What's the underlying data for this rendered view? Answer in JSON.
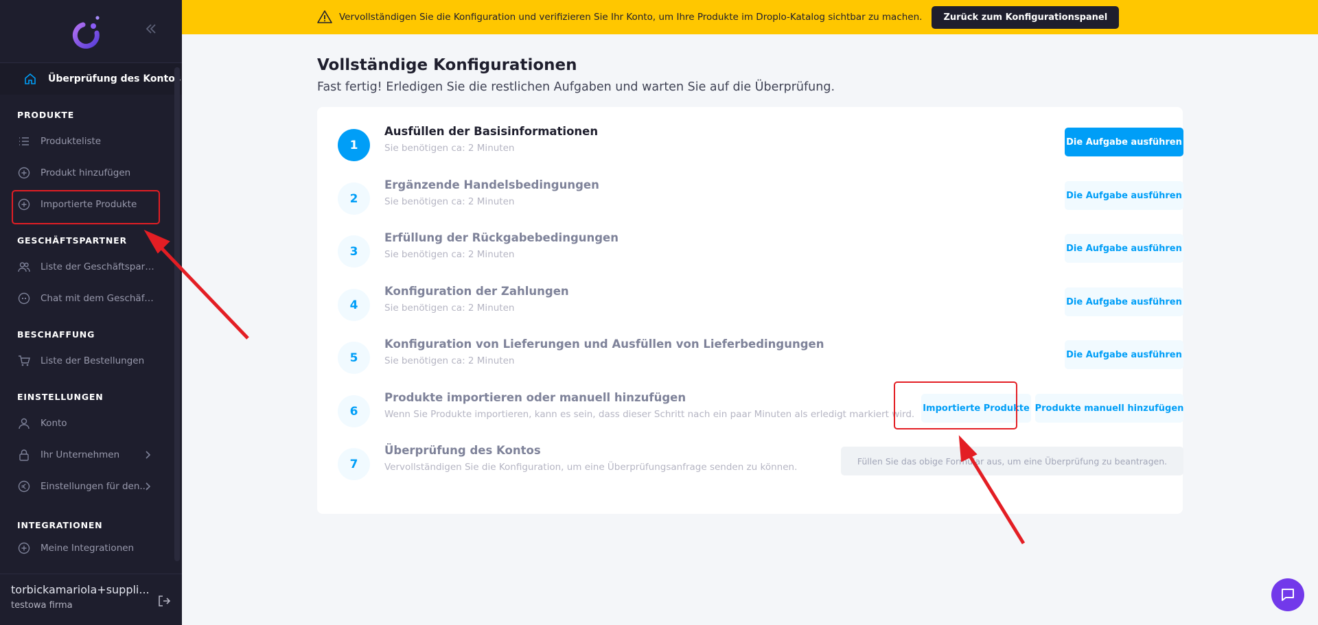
{
  "banner": {
    "text": "Vervollständigen Sie die Konfiguration und verifizieren Sie Ihr Konto, um Ihre Produkte im Droplo-Katalog sichtbar zu machen.",
    "button": "Zurück zum Konfigurationspanel"
  },
  "sidebar": {
    "account_link": "Überprüfung des Kontos",
    "sections": [
      {
        "title": "PRODUKTE",
        "items": [
          "Produkteliste",
          "Produkt hinzufügen",
          "Importierte Produkte"
        ]
      },
      {
        "title": "GESCHÄFTSPARTNER",
        "items": [
          "Liste der Geschäftspartn...",
          "Chat mit dem Geschäfts..."
        ]
      },
      {
        "title": "BESCHAFFUNG",
        "items": [
          "Liste der Bestellungen"
        ]
      },
      {
        "title": "EINSTELLUNGEN",
        "items": [
          "Konto",
          "Ihr Unternehmen",
          "Einstellungen für den..."
        ]
      },
      {
        "title": "INTEGRATIONEN",
        "items": [
          "Meine Integrationen"
        ]
      }
    ],
    "user": {
      "email": "torbickamariola+suppli...",
      "company": "testowa firma"
    }
  },
  "main": {
    "title": "Vollständige Konfigurationen",
    "subtitle": "Fast fertig! Erledigen Sie die restlichen Aufgaben und warten Sie auf die Überprüfung.",
    "steps": [
      {
        "num": "1",
        "title": "Ausfüllen der Basisinformationen",
        "desc": "Sie benötigen ca: 2 Minuten",
        "button": "Die Aufgabe ausführen"
      },
      {
        "num": "2",
        "title": "Ergänzende Handelsbedingungen",
        "desc": "Sie benötigen ca: 2 Minuten",
        "button": "Die Aufgabe ausführen"
      },
      {
        "num": "3",
        "title": "Erfüllung der Rückgabebedingungen",
        "desc": "Sie benötigen ca: 2 Minuten",
        "button": "Die Aufgabe ausführen"
      },
      {
        "num": "4",
        "title": "Konfiguration der Zahlungen",
        "desc": "Sie benötigen ca: 2 Minuten",
        "button": "Die Aufgabe ausführen"
      },
      {
        "num": "5",
        "title": "Konfiguration von Lieferungen und Ausfüllen von Lieferbedingungen",
        "desc": "Sie benötigen ca: 2 Minuten",
        "button": "Die Aufgabe ausführen"
      },
      {
        "num": "6",
        "title": "Produkte importieren oder manuell hinzufügen",
        "desc": "Wenn Sie Produkte importieren, kann es sein, dass dieser Schritt nach ein paar Minuten als erledigt markiert wird.",
        "button_import": "Importierte Produkte",
        "button_manual": "Produkte manuell hinzufügen"
      },
      {
        "num": "7",
        "title": "Überprüfung des Kontos",
        "desc": "Vervollständigen Sie die Konfiguration, um eine Überprüfungsanfrage senden zu können.",
        "button": "Füllen Sie das obige Formular aus, um eine Überprüfung zu beantragen."
      }
    ]
  },
  "colors": {
    "accent": "#009ef7",
    "sidebar": "#1e1e2d",
    "banner": "#ffc700",
    "highlight": "#e31e24",
    "chat": "#7239ea"
  }
}
